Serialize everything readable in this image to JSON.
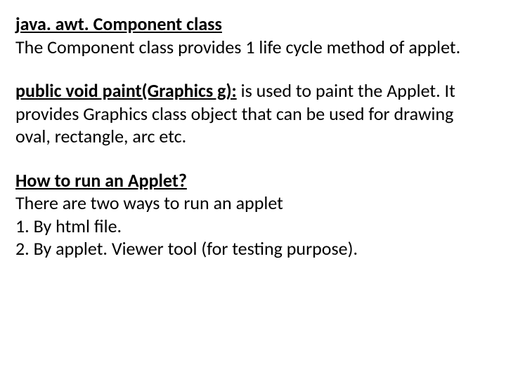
{
  "section1": {
    "heading": "java. awt. Component class",
    "body": "The Component class provides 1 life cycle method of applet."
  },
  "section2": {
    "method": "public void paint(Graphics g):",
    "body": " is used to paint the Applet. It provides Graphics class object that can be used for drawing oval, rectangle, arc etc."
  },
  "section3": {
    "heading": "How to run an Applet?",
    "intro": "There are two ways to run an applet",
    "item1": "1. By html file.",
    "item2": "2. By applet. Viewer tool (for testing purpose)."
  }
}
